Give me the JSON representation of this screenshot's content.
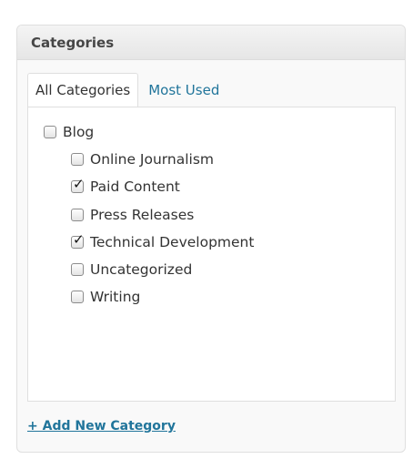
{
  "panel": {
    "title": "Categories"
  },
  "tabs": [
    {
      "label": "All Categories",
      "active": true
    },
    {
      "label": "Most Used",
      "active": false
    }
  ],
  "categories": [
    {
      "label": "Blog",
      "checked": false,
      "level": 0
    },
    {
      "label": "Online Journalism",
      "checked": false,
      "level": 1
    },
    {
      "label": "Paid Content",
      "checked": true,
      "level": 1
    },
    {
      "label": "Press Releases",
      "checked": false,
      "level": 1
    },
    {
      "label": "Technical Development",
      "checked": true,
      "level": 1
    },
    {
      "label": "Uncategorized",
      "checked": false,
      "level": 1
    },
    {
      "label": "Writing",
      "checked": false,
      "level": 1
    }
  ],
  "add_category": {
    "label": "+ Add New Category"
  },
  "colors": {
    "link": "#21759b",
    "text": "#333333",
    "header_text": "#464646"
  }
}
